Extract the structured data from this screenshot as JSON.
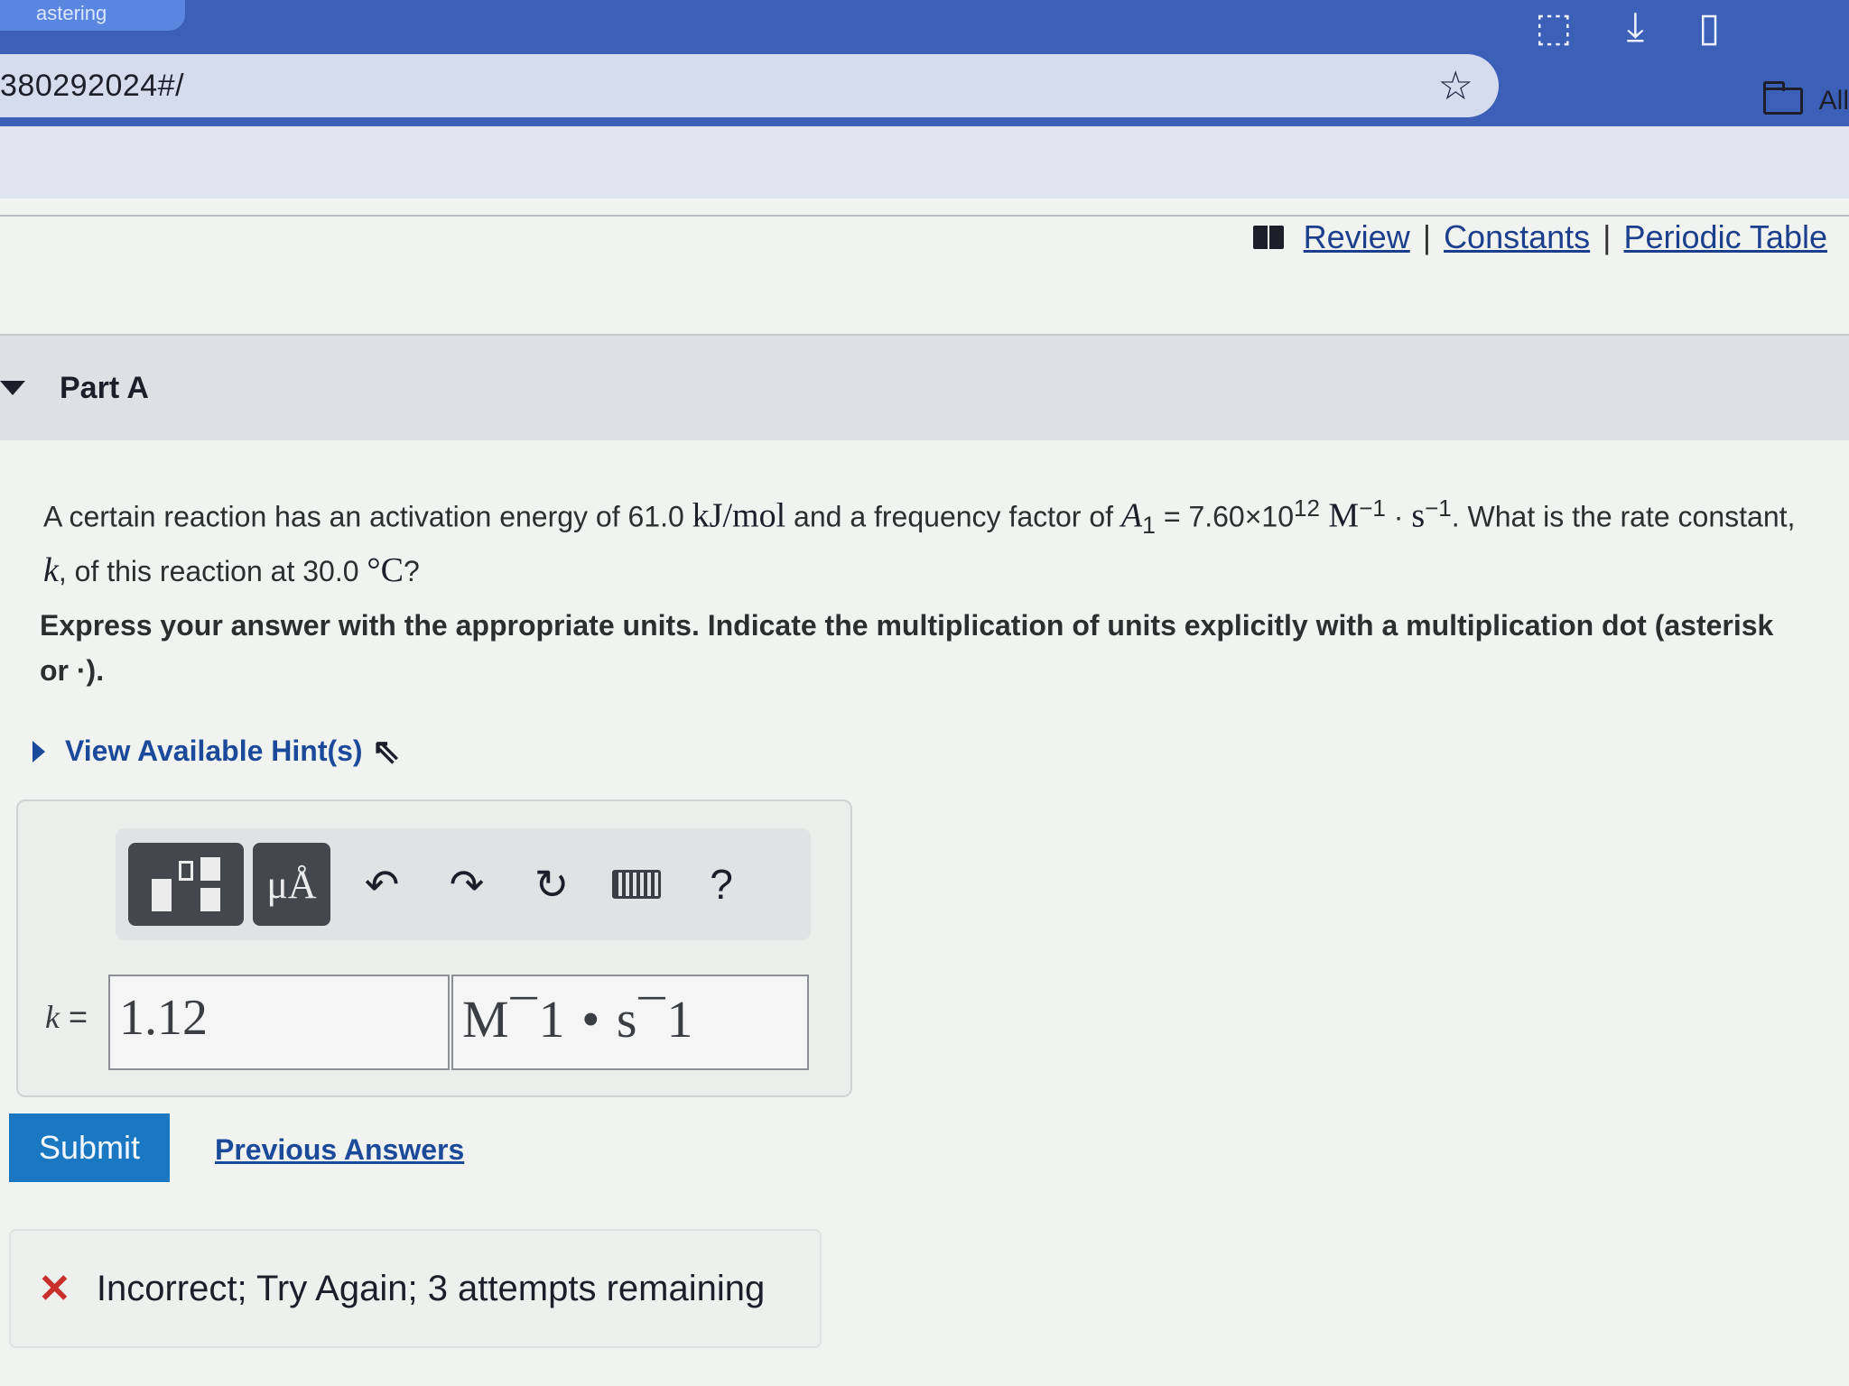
{
  "browser": {
    "tab_title": "astering",
    "address": "380292024#/",
    "bookmark_all": "All"
  },
  "resources": {
    "review": "Review",
    "constants": "Constants",
    "periodic_table": "Periodic Table",
    "sep": "|"
  },
  "part": {
    "title": "Part A"
  },
  "question": {
    "t1": "A certain reaction has an activation energy of 61.0 ",
    "unit1": "kJ/mol",
    "t2": " and a frequency factor of ",
    "A_sym": "A",
    "A_sub": "1",
    "eq": " = 7.60×10",
    "exp": "12",
    "M": " M",
    "m_exp": "−1",
    "dot": " · ",
    "s": "s",
    "s_exp": "−1",
    "t3": ". What is the rate constant, ",
    "k": "k",
    "t4": ", of this reaction at 30.0 ",
    "deg": "°C",
    "t5": "?"
  },
  "instructions": "Express your answer with the appropriate units. Indicate the multiplication of units explicitly with a multiplication dot (asterisk or ·).",
  "hint": "View Available Hint(s)",
  "toolbar": {
    "units_glyph": "μÅ",
    "undo": "↶",
    "redo": "↷",
    "reset": "↻",
    "help": "?"
  },
  "answer": {
    "k_label": "k",
    "eq": " =",
    "value": "1.12",
    "units": "M¯1 • s¯1"
  },
  "actions": {
    "submit": "Submit",
    "previous_answers": "Previous Answers"
  },
  "feedback": {
    "icon": "✕",
    "text": "Incorrect; Try Again; 3 attempts remaining"
  },
  "colors": {
    "accent": "#1a78c2",
    "link": "#1b4a9a",
    "error": "#c9302c"
  }
}
